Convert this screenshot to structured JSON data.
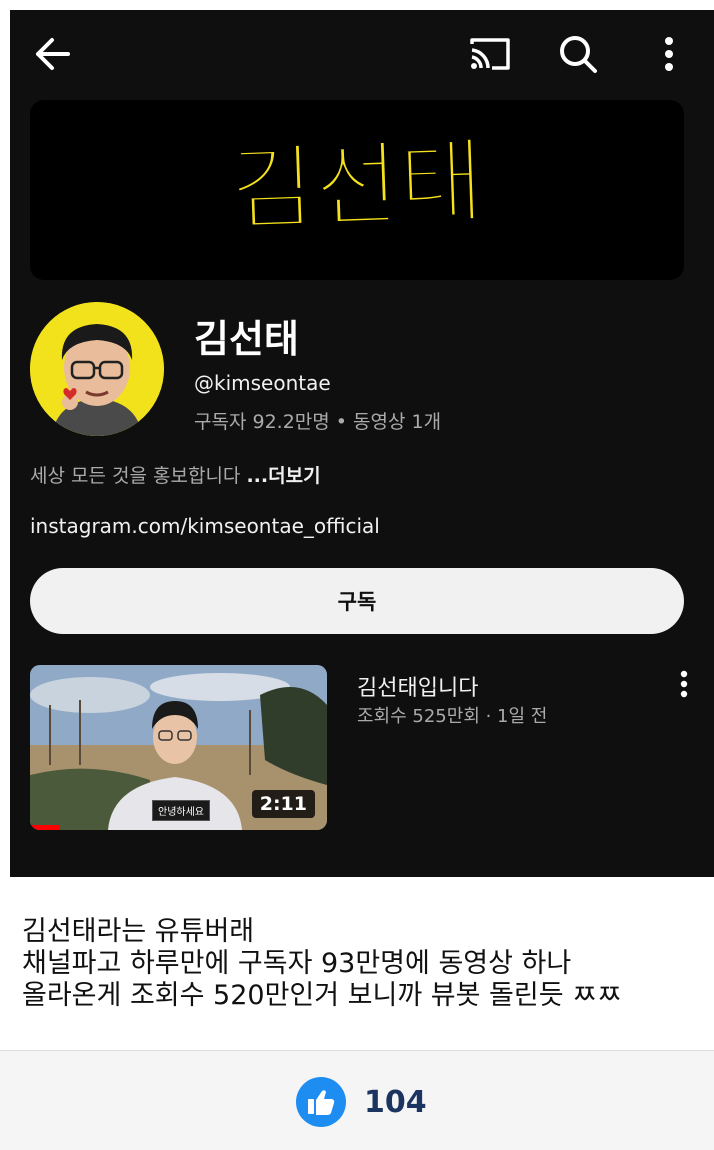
{
  "topbar": {
    "back_icon": "arrow-left-icon",
    "cast_icon": "cast-icon",
    "search_icon": "search-icon",
    "more_icon": "more-vert-icon"
  },
  "banner": {
    "text": "김선태",
    "color": "#f5e21b"
  },
  "channel": {
    "name": "김선태",
    "handle": "@kimseontae",
    "stats": "구독자 92.2만명 • 동영상 1개",
    "description": "세상 모든 것을 홍보합니다 ",
    "more": "...더보기",
    "link": "instagram.com/kimseontae_official"
  },
  "subscribe_label": "구독",
  "video": {
    "title": "김선태입니다",
    "meta": "조회수 525만회 · 1일 전",
    "duration": "2:11",
    "caption": "안녕하세요",
    "progress": 0.1
  },
  "post": {
    "text": "김선태라는 유튜버래\n채널파고 하루만에 구독자 93만명에 동영상 하나\n올라온게 조회수 520만인거 보니까 뷰봇 돌린듯 ㅉㅉ"
  },
  "like": {
    "count": "104",
    "icon": "thumbs-up-icon",
    "color": "#1d8df2"
  }
}
